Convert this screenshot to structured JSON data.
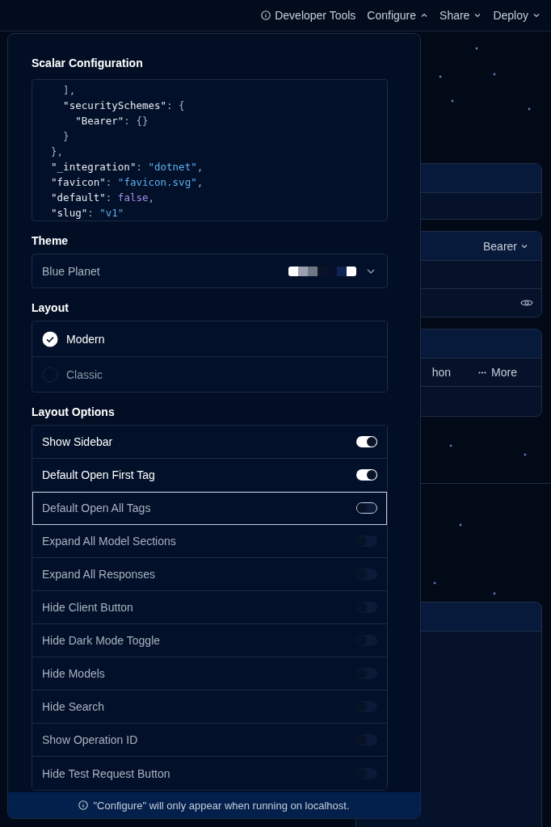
{
  "top_nav": [
    {
      "kind": "info",
      "label": "Developer Tools"
    },
    {
      "kind": "menu",
      "label": "Configure",
      "expanded": true
    },
    {
      "kind": "menu",
      "label": "Share",
      "expanded": false
    },
    {
      "kind": "menu",
      "label": "Deploy",
      "expanded": false
    }
  ],
  "background": {
    "auth_scheme": "Bearer",
    "client_tabs": [
      "hon",
      "More"
    ]
  },
  "config_panel": {
    "title": "Scalar Configuration",
    "code_lines": [
      [
        {
          "kind": "punct",
          "text": "    ],"
        }
      ],
      [
        {
          "kind": "key",
          "text": "    \"securitySchemes\""
        },
        {
          "kind": "punct",
          "text": ": {"
        }
      ],
      [
        {
          "kind": "key",
          "text": "      \"Bearer\""
        },
        {
          "kind": "punct",
          "text": ": {}"
        }
      ],
      [
        {
          "kind": "punct",
          "text": "    }"
        }
      ],
      [
        {
          "kind": "punct",
          "text": "  },"
        }
      ],
      [
        {
          "kind": "key",
          "text": "  \"_integration\""
        },
        {
          "kind": "punct",
          "text": ": "
        },
        {
          "kind": "string",
          "text": "\"dotnet\""
        },
        {
          "kind": "punct",
          "text": ","
        }
      ],
      [
        {
          "kind": "key",
          "text": "  \"favicon\""
        },
        {
          "kind": "punct",
          "text": ": "
        },
        {
          "kind": "string",
          "text": "\"favicon.svg\""
        },
        {
          "kind": "punct",
          "text": ","
        }
      ],
      [
        {
          "kind": "key",
          "text": "  \"default\""
        },
        {
          "kind": "punct",
          "text": ": "
        },
        {
          "kind": "bool",
          "text": "false"
        },
        {
          "kind": "punct",
          "text": ","
        }
      ],
      [
        {
          "kind": "key",
          "text": "  \"slug\""
        },
        {
          "kind": "punct",
          "text": ": "
        },
        {
          "kind": "string",
          "text": "\"v1\""
        }
      ]
    ],
    "theme_label": "Theme",
    "theme": {
      "value": "Blue Planet"
    },
    "layout_label": "Layout",
    "layouts": [
      {
        "label": "Modern",
        "selected": true
      },
      {
        "label": "Classic",
        "selected": false
      }
    ],
    "options_label": "Layout Options",
    "options": [
      {
        "label": "Show Sidebar",
        "on": true,
        "focused": false
      },
      {
        "label": "Default Open First Tag",
        "on": true,
        "focused": false
      },
      {
        "label": "Default Open All Tags",
        "on": false,
        "focused": true
      },
      {
        "label": "Expand All Model Sections",
        "on": false,
        "focused": false
      },
      {
        "label": "Expand All Responses",
        "on": false,
        "focused": false
      },
      {
        "label": "Hide Client Button",
        "on": false,
        "focused": false
      },
      {
        "label": "Hide Dark Mode Toggle",
        "on": false,
        "focused": false
      },
      {
        "label": "Hide Models",
        "on": false,
        "focused": false
      },
      {
        "label": "Hide Search",
        "on": false,
        "focused": false
      },
      {
        "label": "Show Operation ID",
        "on": false,
        "focused": false
      },
      {
        "label": "Hide Test Request Button",
        "on": false,
        "focused": false
      }
    ],
    "footer_note": "\"Configure\" will only appear when running on localhost."
  }
}
